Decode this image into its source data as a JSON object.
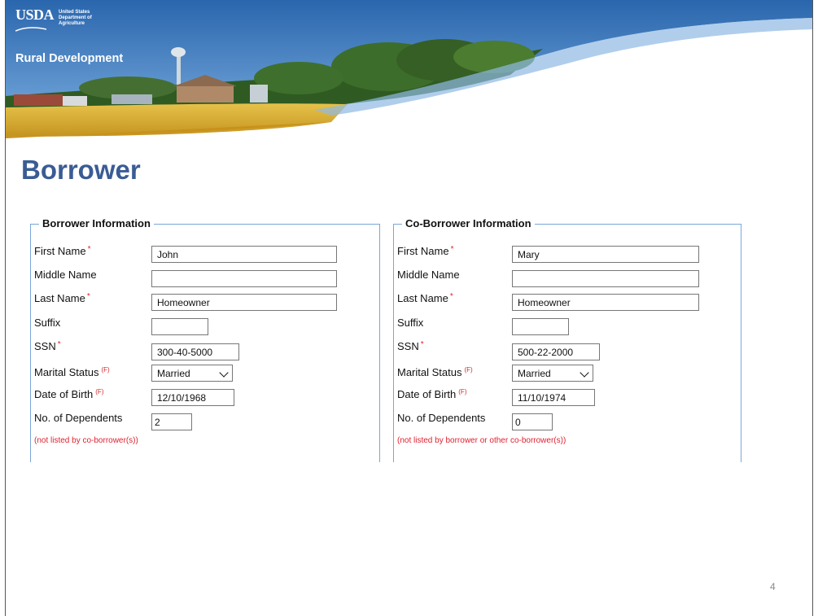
{
  "banner": {
    "logo_mark": "USDA",
    "logo_line1": "United States",
    "logo_line2": "Department of",
    "logo_line3": "Agriculture",
    "agency": "Rural Development"
  },
  "page": {
    "title": "Borrower",
    "number": "4"
  },
  "borrower": {
    "legend": "Borrower Information",
    "labels": {
      "first": "First Name",
      "middle": "Middle Name",
      "last": "Last Name",
      "suffix": "Suffix",
      "ssn": "SSN",
      "marital": "Marital Status",
      "dob": "Date of Birth",
      "dependents": "No. of Dependents"
    },
    "required_mark": "*",
    "form_mark": "(F)",
    "values": {
      "first": "John",
      "middle": "",
      "last": "Homeowner",
      "suffix": "",
      "ssn": "300-40-5000",
      "marital": "Married",
      "dob": "12/10/1968",
      "dependents": "2"
    },
    "note": "(not listed by co-borrower(s))"
  },
  "coborrower": {
    "legend": "Co-Borrower Information",
    "labels": {
      "first": "First Name",
      "middle": "Middle Name",
      "last": "Last Name",
      "suffix": "Suffix",
      "ssn": "SSN",
      "marital": "Marital Status",
      "dob": "Date of Birth",
      "dependents": "No. of Dependents"
    },
    "required_mark": "*",
    "form_mark": "(F)",
    "values": {
      "first": "Mary",
      "middle": "",
      "last": "Homeowner",
      "suffix": "",
      "ssn": "500-22-2000",
      "marital": "Married",
      "dob": "11/10/1974",
      "dependents": "0"
    },
    "note": "(not listed by borrower or other co-borrower(s))"
  },
  "colors": {
    "title": "#3a5c95",
    "banner_blue": "#2f6fb3",
    "field_wheat": "#d9b23a",
    "required_red": "#d62828",
    "panel_border": "#7aa6d6"
  }
}
